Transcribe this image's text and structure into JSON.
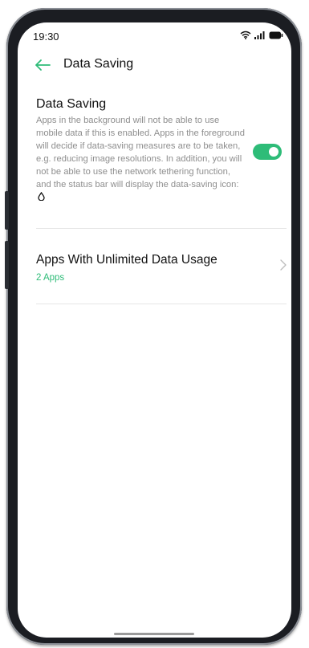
{
  "status_bar": {
    "time": "19:30",
    "icons": [
      "wifi-icon",
      "signal-icon",
      "battery-icon"
    ]
  },
  "header": {
    "back_icon": "back-arrow-icon",
    "title": "Data Saving"
  },
  "data_saving": {
    "title": "Data Saving",
    "description": "Apps in the background will not be able to use mobile data if this is enabled. Apps in the foreground will decide if data-saving measures are to be taken, e.g. reducing image resolutions. In addition, you will not be able to use the network tethering function, and the status bar will display the data-saving icon:",
    "inline_icon": "data-saving-droplet-icon",
    "toggle_on": true
  },
  "unlimited_data": {
    "title": "Apps With Unlimited Data Usage",
    "subtitle": "2 Apps",
    "chevron_icon": "chevron-right-icon"
  },
  "colors": {
    "accent": "#2ebc78",
    "text_primary": "#111111",
    "text_secondary": "#8e8e8e",
    "divider": "#e6e6e6"
  }
}
